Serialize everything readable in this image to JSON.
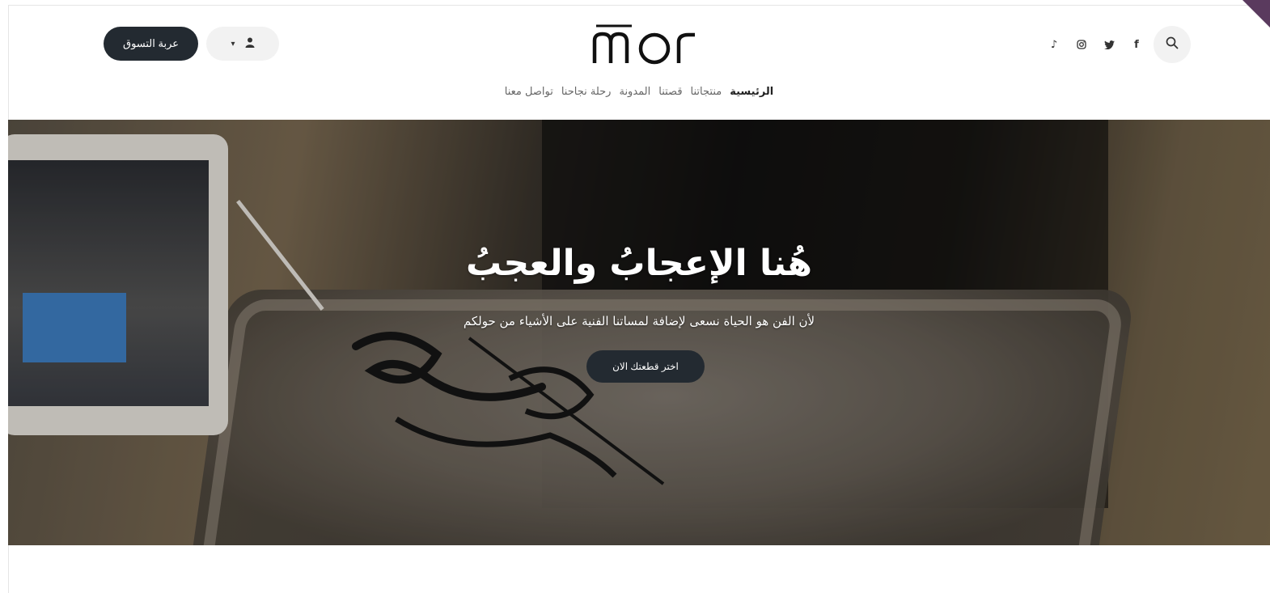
{
  "header": {
    "cart_label": "عربة التسوق",
    "account_icon": "user-icon",
    "account_caret": "▾",
    "logo_text": "mor",
    "social_icons": [
      "tiktok-icon",
      "instagram-icon",
      "twitter-icon",
      "facebook-icon"
    ],
    "social_glyphs": {
      "tiktok": "♪",
      "instagram": "◎",
      "twitter": "🐦",
      "facebook": "f"
    },
    "search_icon": "search-icon"
  },
  "nav": {
    "items": [
      "الرئيسية",
      "منتجاتنا",
      "قصتنا",
      "المدونة",
      "رحلة نجاحنا",
      "تواصل معنا"
    ]
  },
  "hero": {
    "title": "هُنا الإعجابُ والعجبُ",
    "subtitle": "لأن الفن هو الحياة نسعى لإضافة لمساتنا الفنية على الأشياء من حولكم",
    "cta_label": "اختر قطعتك الان"
  },
  "colors": {
    "primary_dark": "#232a31",
    "light_pill": "#f2f2f2",
    "ribbon": "#5a3a5e"
  }
}
